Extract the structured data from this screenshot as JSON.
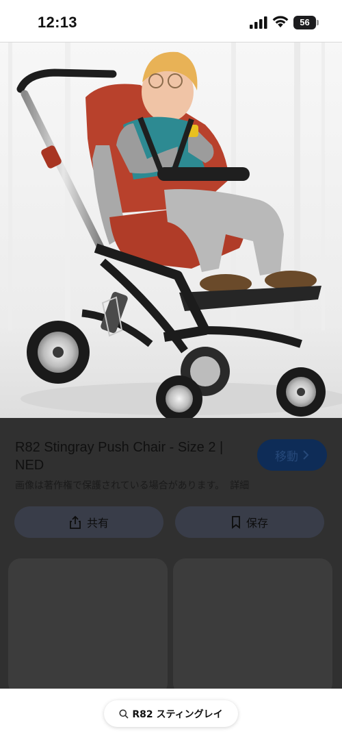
{
  "status_bar": {
    "time": "12:13",
    "battery_level": "56"
  },
  "result": {
    "title": "R82 Stingray Push Chair - Size 2 | NED",
    "visit_label": "移動",
    "copyright_notice": "画像は著作権で保護されている場合があります。",
    "detail_link": "詳細",
    "share_label": "共有",
    "save_label": "保存"
  },
  "search": {
    "query": "R82 スティングレイ"
  },
  "colors": {
    "overlay": "#303030",
    "visit_button": "#0e2c57",
    "action_button": "#393d49",
    "stroller_seat": "#b8412c"
  },
  "icons": [
    "signal-icon",
    "wifi-icon",
    "battery-icon",
    "share-icon",
    "bookmark-icon",
    "chevron-right-icon",
    "search-icon"
  ]
}
